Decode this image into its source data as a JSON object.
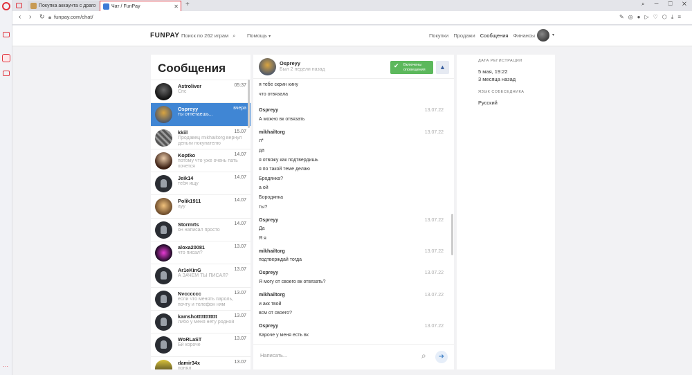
{
  "browser": {
    "tabs": [
      {
        "label": "Покупка аккаунта с драго"
      },
      {
        "label": "Чат / FunPay"
      }
    ],
    "url": "funpay.com/chat/"
  },
  "site": {
    "logo_main": "FUN",
    "logo_sub": "PAY",
    "search_label": "Поиск по 262 играм",
    "help_label": "Помощь",
    "nav": [
      "Покупки",
      "Продажи",
      "Сообщения",
      "Финансы"
    ],
    "active_nav_index": 2
  },
  "messages_panel": {
    "title": "Сообщения",
    "threads": [
      {
        "name": "Astroliver",
        "date": "05:37",
        "preview": "Спс"
      },
      {
        "name": "Ospreyy",
        "date": "вчера",
        "preview": "ты отпетаешь..."
      },
      {
        "name": "kkiil",
        "date": "15.07",
        "preview": "Продавец mikhailtorg вернул деньги покупателю"
      },
      {
        "name": "Koptko",
        "date": "14.07",
        "preview": "потому что уже очень пать хочется"
      },
      {
        "name": "Jeik14",
        "date": "14.07",
        "preview": "тебя ищу"
      },
      {
        "name": "Polik1911",
        "date": "14.07",
        "preview": "ауу"
      },
      {
        "name": "Stormrts",
        "date": "14.07",
        "preview": "он написал просто"
      },
      {
        "name": "aloxa20081",
        "date": "13.07",
        "preview": "что писал?"
      },
      {
        "name": "Ar1eKinG",
        "date": "13.07",
        "preview": "А ЗАЧЕМ ТЫ ПИСАЛ?"
      },
      {
        "name": "Nvcccccc",
        "date": "13.07",
        "preview": "если что менять пароль, почту и телефон ням"
      },
      {
        "name": "kamshotttttttttttt",
        "date": "13.07",
        "preview": "либо у меня нету родной"
      },
      {
        "name": "WoRLaST",
        "date": "13.07",
        "preview": "Бй короче"
      },
      {
        "name": "damir34x",
        "date": "13.07",
        "preview": "понял"
      }
    ]
  },
  "chat": {
    "name": "Ospreyy",
    "status": "Был 2 недели назад",
    "notif_line1": "Включены",
    "notif_line2": "оповещения",
    "input_placeholder": "Написать...",
    "messages": [
      {
        "author": "",
        "time": "",
        "lines": [
          "я тебе скрин кину",
          "что отвязала"
        ]
      },
      {
        "author": "Ospreyy",
        "time": "13.07.22",
        "lines": [
          "А можно вк отвязать"
        ]
      },
      {
        "author": "mikhailtorg",
        "time": "13.07.22",
        "lines": [
          "л*",
          "да",
          "я отвяжу как подтвердишь",
          "я по такой теме делаю",
          "Бродянка?",
          "а ой",
          "Бородянка",
          "ты?"
        ]
      },
      {
        "author": "Ospreyy",
        "time": "13.07.22",
        "lines": [
          "Да",
          "Я я"
        ]
      },
      {
        "author": "mikhailtorg",
        "time": "13.07.22",
        "lines": [
          "подтверждай тогда"
        ]
      },
      {
        "author": "Ospreyy",
        "time": "13.07.22",
        "lines": [
          "Я могу от своего вк отвязать?"
        ]
      },
      {
        "author": "mikhailtorg",
        "time": "13.07.22",
        "lines": [
          "и акк твой",
          "всм от своего?"
        ]
      },
      {
        "author": "Ospreyy",
        "time": "13.07.22",
        "lines": [
          "Кароче у меня есть вк"
        ]
      }
    ]
  },
  "info": {
    "reg_label": "ДАТА РЕГИСТРАЦИИ",
    "reg_date": "5 мая, 19:22",
    "reg_ago": "3 месяца назад",
    "lang_label": "ЯЗЫК СОБЕСЕДНИКА",
    "lang": "Русский"
  }
}
